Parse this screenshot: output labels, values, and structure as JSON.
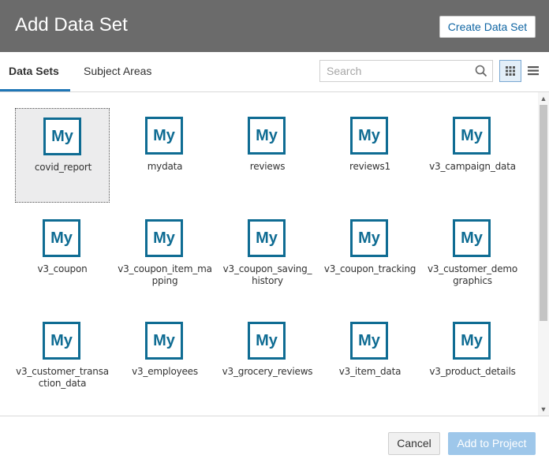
{
  "header": {
    "title": "Add Data Set",
    "create_button_label": "Create Data Set",
    "background": "#6b6b6b"
  },
  "tabs": [
    {
      "label": "Data Sets",
      "active": true
    },
    {
      "label": "Subject Areas",
      "active": false
    }
  ],
  "search": {
    "placeholder": "Search",
    "value": ""
  },
  "view_toggle": {
    "grid_icon": "grid-view-icon",
    "list_icon": "list-view-icon",
    "selected": "grid"
  },
  "datasets": [
    {
      "name": "covid_report",
      "icon_text": "My",
      "selected": true
    },
    {
      "name": "mydata",
      "icon_text": "My"
    },
    {
      "name": "reviews",
      "icon_text": "My"
    },
    {
      "name": "reviews1",
      "icon_text": "My"
    },
    {
      "name": "v3_campaign_data",
      "icon_text": "My"
    },
    {
      "name": "v3_coupon",
      "icon_text": "My"
    },
    {
      "name": "v3_coupon_item_mapping",
      "icon_text": "My"
    },
    {
      "name": "v3_coupon_saving_history",
      "icon_text": "My"
    },
    {
      "name": "v3_coupon_tracking",
      "icon_text": "My"
    },
    {
      "name": "v3_customer_demographics",
      "icon_text": "My"
    },
    {
      "name": "v3_customer_transaction_data",
      "icon_text": "My"
    },
    {
      "name": "v3_employees",
      "icon_text": "My"
    },
    {
      "name": "v3_grocery_reviews",
      "icon_text": "My"
    },
    {
      "name": "v3_item_data",
      "icon_text": "My"
    },
    {
      "name": "v3_product_details",
      "icon_text": "My"
    }
  ],
  "footer": {
    "cancel_label": "Cancel",
    "add_label": "Add to Project",
    "add_enabled": false
  },
  "colors": {
    "accent": "#1f76b6",
    "icon_blue": "#0f6c93",
    "disabled_button": "#9ec7ea"
  }
}
